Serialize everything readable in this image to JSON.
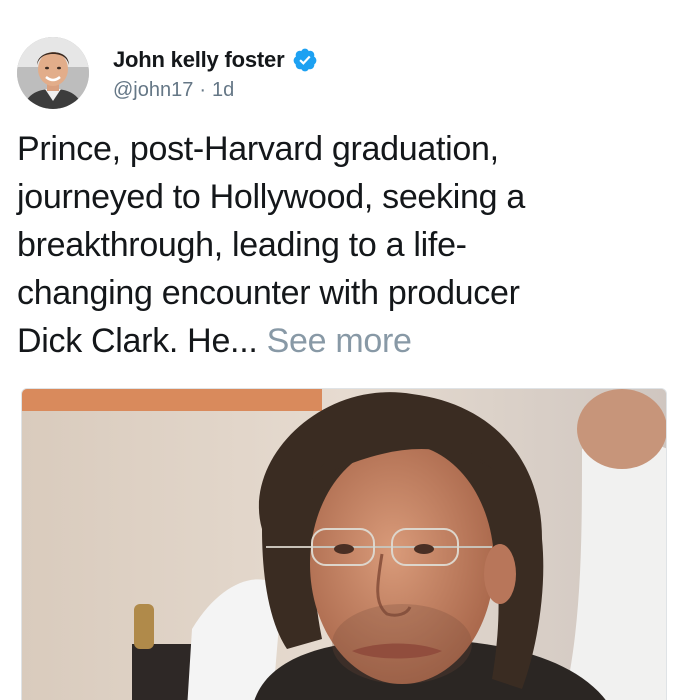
{
  "author": {
    "display_name": "John kelly foster",
    "handle": "@john17",
    "separator": "·",
    "timestamp": "1d",
    "verified": true,
    "avatar_icon": "profile-photo"
  },
  "tweet": {
    "text_lines": [
      "Prince, post-Harvard graduation,",
      "journeyed to Hollywood, seeking a",
      "breakthrough, leading to a life-",
      "changing encounter with producer"
    ],
    "last_line": "Dick Clark. He...",
    "see_more_label": "See more"
  },
  "media": {
    "type": "photo",
    "icon": "photo-of-man-with-glasses"
  },
  "colors": {
    "verified_blue": "#1da1f2",
    "text_primary": "#14171a",
    "text_secondary": "#657786",
    "see_more": "#8899a6"
  }
}
